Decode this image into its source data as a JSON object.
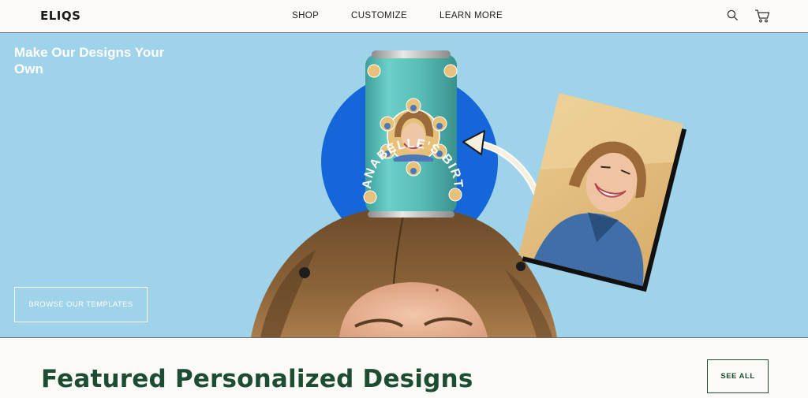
{
  "header": {
    "logo": "ELIQS",
    "nav": [
      "SHOP",
      "CUSTOMIZE",
      "LEARN MORE"
    ],
    "icons": [
      "search-icon",
      "cart-icon"
    ]
  },
  "hero": {
    "title": "Make Our Designs Your Own",
    "button_label": "BROWSE OUR TEMPLATES",
    "can_text": "ANABELLE'S BIRTHDAY BOOZE",
    "colors": {
      "background": "#9ed3ea",
      "circle": "#1565d8",
      "can": "#5bbcb6"
    }
  },
  "featured": {
    "title": "Featured Personalized Designs",
    "see_all_label": "SEE ALL"
  }
}
